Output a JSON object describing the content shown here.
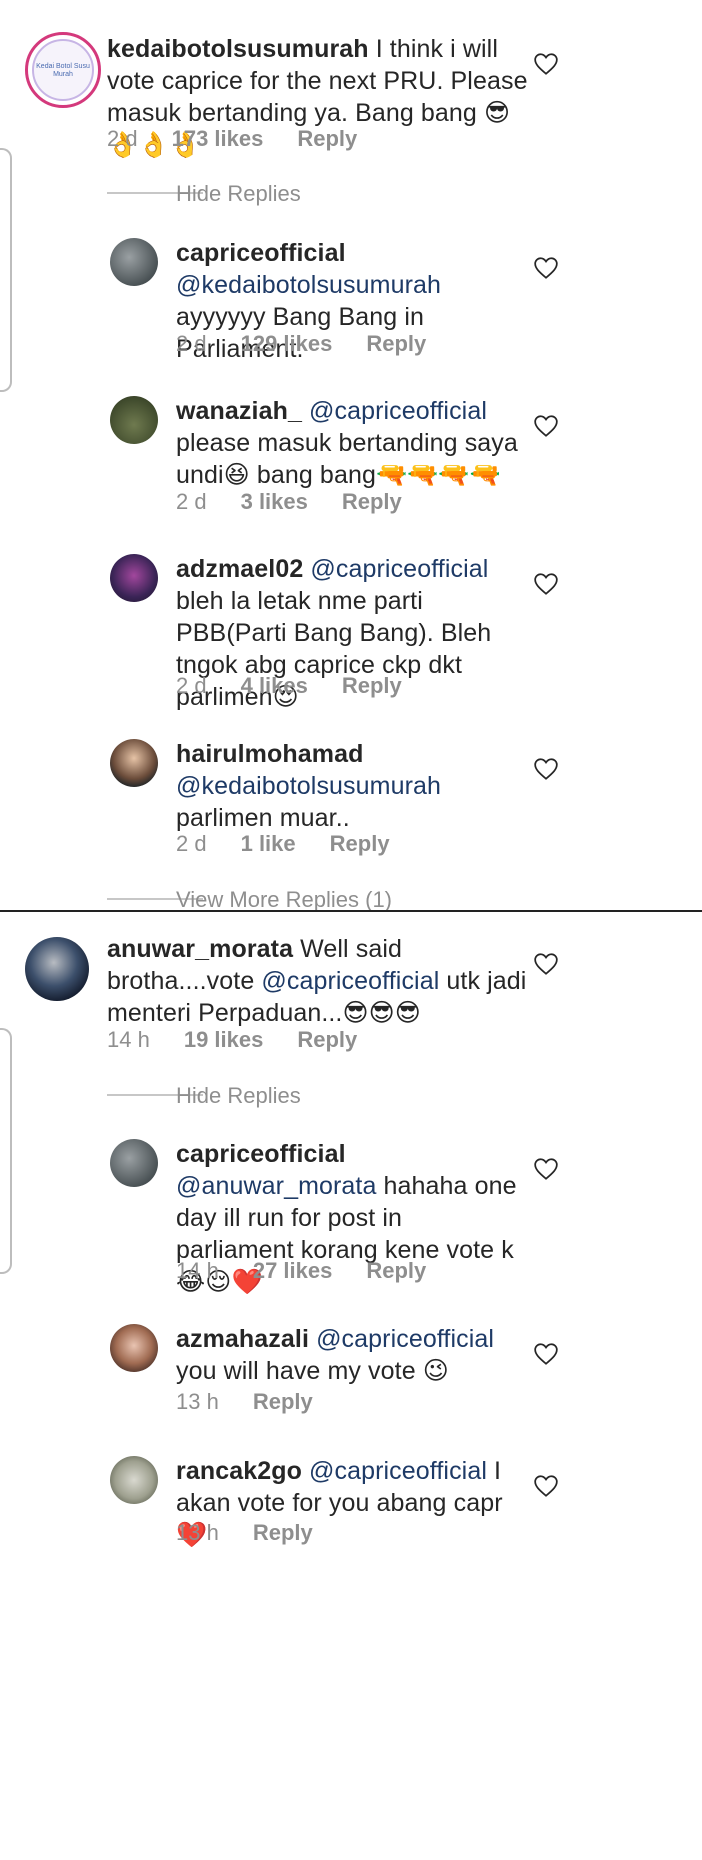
{
  "threads": [
    {
      "parent": {
        "username": "kedaibotolsusumurah",
        "text": "I think i will vote caprice for the next PRU. Please masuk bertanding ya. Bang bang 😎👌👌👌",
        "time": "2 d",
        "likes": "173 likes",
        "reply": "Reply",
        "avatar_text": "Kedai Botol Susu Murah"
      },
      "toggle": "Hide Replies",
      "replies": [
        {
          "username": "capriceofficial",
          "mention": "@kedaibotolsusumurah",
          "text": "ayyyyyy Bang Bang in Parliament.",
          "time": "2 d",
          "likes": "129 likes",
          "reply": "Reply"
        },
        {
          "username": "wanaziah_",
          "mention": "@capriceofficial",
          "text": "please masuk bertanding saya undi😆 bang bang🔫🔫🔫🔫",
          "time": "2 d",
          "likes": "3 likes",
          "reply": "Reply"
        },
        {
          "username": "adzmael02",
          "mention": "@capriceofficial",
          "text": "bleh la letak nme parti PBB(Parti Bang Bang). Bleh tngok abg caprice ckp dkt parlimen😍",
          "time": "2 d",
          "likes": "4 likes",
          "reply": "Reply"
        },
        {
          "username": "hairulmohamad",
          "mention": "@kedaibotolsusumurah",
          "text": "parlimen muar..",
          "time": "2 d",
          "likes": "1 like",
          "reply": "Reply"
        }
      ],
      "view_more": "View More Replies (1)"
    },
    {
      "parent": {
        "username": "anuwar_morata",
        "text_before": "Well said brotha....vote",
        "mention": "@capriceofficial",
        "text_after": "utk jadi menteri Perpaduan...😎😎😎",
        "time": "14 h",
        "likes": "19 likes",
        "reply": "Reply"
      },
      "toggle": "Hide Replies",
      "replies": [
        {
          "username": "capriceofficial",
          "mention": "@anuwar_morata",
          "text": "hahaha one day ill run for post in parliament korang kene vote k😂😌❤️",
          "time": "14 h",
          "likes": "27 likes",
          "reply": "Reply"
        },
        {
          "username": "azmahazali",
          "mention": "@capriceofficial",
          "text": "you will have my vote 😉",
          "time": "13 h",
          "likes": "",
          "reply": "Reply"
        },
        {
          "username": "rancak2go",
          "mention": "@capriceofficial",
          "text": "I akan vote for you abang capr ❤️",
          "time": "13 h",
          "likes": "",
          "reply": "Reply"
        }
      ]
    }
  ],
  "colors": {
    "mention": "#1e3a66",
    "meta": "#8e8e8e",
    "text": "#262626",
    "heart": "#262626"
  },
  "icons": {
    "like": "heart-outline-icon"
  }
}
